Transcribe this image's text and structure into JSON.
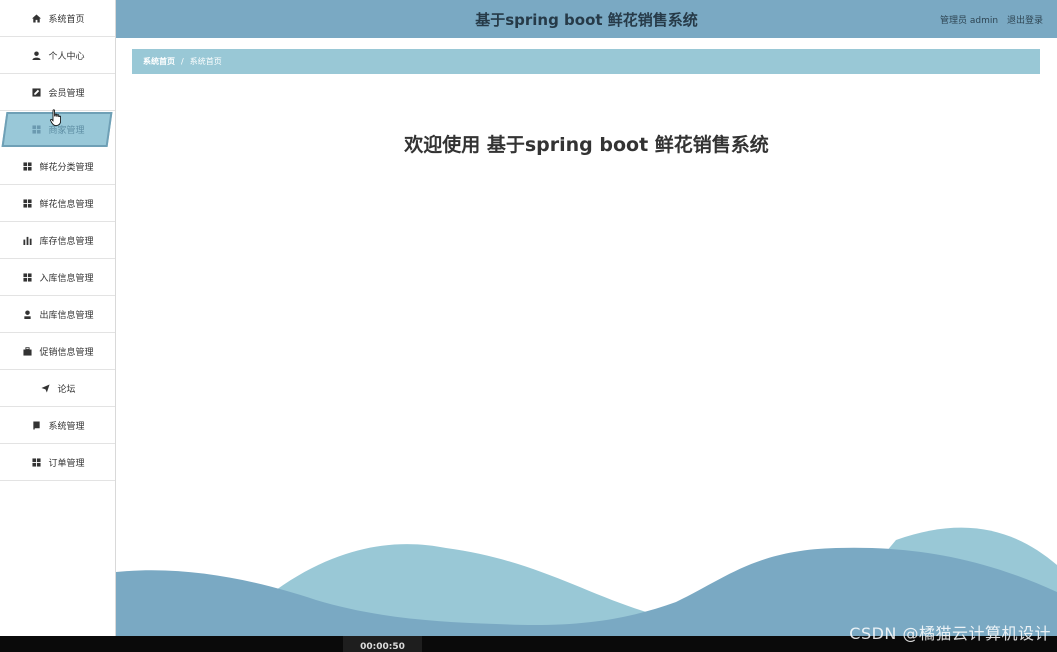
{
  "header": {
    "title": "基于spring boot 鲜花销售系统",
    "user_role": "管理员",
    "username": "admin",
    "logout_label": "退出登录"
  },
  "sidebar": {
    "items": [
      {
        "label": "系统首页",
        "icon": "home-icon"
      },
      {
        "label": "个人中心",
        "icon": "user-icon"
      },
      {
        "label": "会员管理",
        "icon": "edit-icon"
      },
      {
        "label": "商家管理",
        "icon": "grid-icon"
      },
      {
        "label": "鲜花分类管理",
        "icon": "grid-icon"
      },
      {
        "label": "鲜花信息管理",
        "icon": "grid-icon"
      },
      {
        "label": "库存信息管理",
        "icon": "bar-chart-icon"
      },
      {
        "label": "入库信息管理",
        "icon": "grid-icon"
      },
      {
        "label": "出库信息管理",
        "icon": "user-icon"
      },
      {
        "label": "促销信息管理",
        "icon": "briefcase-icon"
      },
      {
        "label": "论坛",
        "icon": "send-icon"
      },
      {
        "label": "系统管理",
        "icon": "book-icon"
      },
      {
        "label": "订单管理",
        "icon": "grid-icon"
      }
    ],
    "active_index": 3
  },
  "breadcrumb": {
    "home": "系统首页",
    "separator": "/",
    "current": "系统首页"
  },
  "main": {
    "welcome": "欢迎使用 基于spring boot 鲜花销售系统"
  },
  "watermark": "CSDN @橘猫云计算机设计",
  "timer": "00:00:50",
  "colors": {
    "header_bg": "#7aa9c3",
    "accent": "#99c8d6",
    "wave_dark": "#7aa9c3",
    "wave_light": "#99c8d6"
  }
}
